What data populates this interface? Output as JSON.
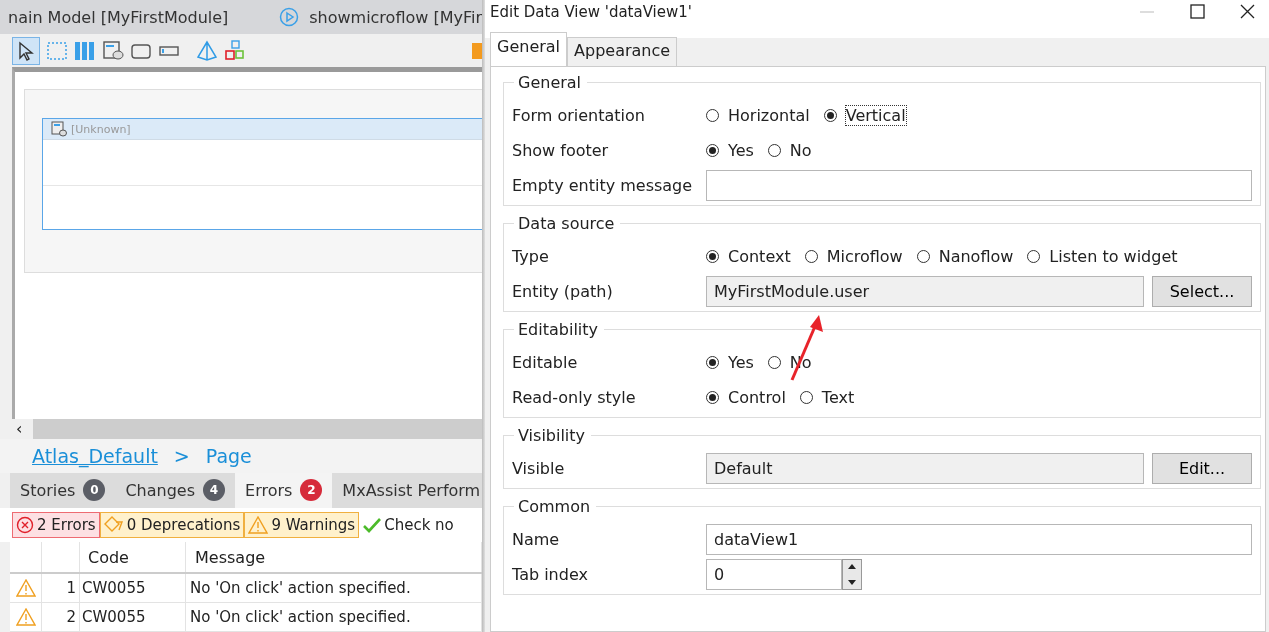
{
  "editor": {
    "tabs": [
      {
        "kind": "model",
        "label": "nain Model [MyFirstModule]"
      },
      {
        "kind": "microflow",
        "label": "showmicroflow [MyFir"
      }
    ],
    "canvas": {
      "widget_label": "[Unknown]"
    },
    "scroll_button": "‹",
    "breadcrumb": {
      "link": "Atlas_Default",
      "separator": ">",
      "current": "Page"
    },
    "panel_tabs": [
      {
        "label": "Stories",
        "count": "0",
        "color": "#5b5e66",
        "selected": false
      },
      {
        "label": "Changes",
        "count": "4",
        "color": "#5b5e66",
        "selected": false
      },
      {
        "label": "Errors",
        "count": "2",
        "color": "#d62b3a",
        "selected": true
      },
      {
        "label": "MxAssist Perform",
        "selected": false
      }
    ],
    "filters": [
      {
        "kind": "error",
        "label": "2 Errors"
      },
      {
        "kind": "deprecation",
        "label": "0 Deprecations"
      },
      {
        "kind": "warning",
        "label": "9 Warnings"
      },
      {
        "kind": "check",
        "label": "Check no"
      }
    ],
    "table": {
      "columns": [
        "Code",
        "Message"
      ],
      "rows": [
        {
          "kind": "warning",
          "index": "1",
          "code": "CW0055",
          "message": "No 'On click' action specified."
        },
        {
          "kind": "warning",
          "index": "2",
          "code": "CW0055",
          "message": "No 'On click' action specified."
        }
      ]
    }
  },
  "dialog": {
    "title": "Edit Data View 'dataView1'",
    "tabs": [
      {
        "label": "General",
        "selected": true
      },
      {
        "label": "Appearance",
        "selected": false
      }
    ],
    "groups": [
      {
        "title": "General",
        "rows": [
          {
            "kind": "radio",
            "label": "Form orientation",
            "options": [
              {
                "label": "Horizontal",
                "selected": false,
                "focused": false
              },
              {
                "label": "Vertical",
                "selected": true,
                "focused": true
              }
            ]
          },
          {
            "kind": "radio",
            "label": "Show footer",
            "options": [
              {
                "label": "Yes",
                "selected": true,
                "focused": false
              },
              {
                "label": "No",
                "selected": false,
                "focused": false
              }
            ]
          },
          {
            "kind": "text",
            "label": "Empty entity message"
          }
        ]
      },
      {
        "title": "Data source",
        "rows": [
          {
            "kind": "radio",
            "label": "Type",
            "options": [
              {
                "label": "Context",
                "selected": true,
                "focused": false
              },
              {
                "label": "Microflow",
                "selected": false,
                "focused": false
              },
              {
                "label": "Nanoflow",
                "selected": false,
                "focused": false
              },
              {
                "label": "Listen to widget",
                "selected": false,
                "focused": false
              }
            ]
          },
          {
            "kind": "picker",
            "label": "Entity (path)",
            "value": "MyFirstModule.user",
            "button": "Select..."
          }
        ]
      },
      {
        "title": "Editability",
        "rows": [
          {
            "kind": "radio",
            "label": "Editable",
            "options": [
              {
                "label": "Yes",
                "selected": true,
                "focused": false
              },
              {
                "label": "No",
                "selected": false,
                "focused": false
              }
            ]
          },
          {
            "kind": "radio",
            "label": "Read-only style",
            "options": [
              {
                "label": "Control",
                "selected": true,
                "focused": false
              },
              {
                "label": "Text",
                "selected": false,
                "focused": false
              }
            ]
          }
        ]
      },
      {
        "title": "Visibility",
        "rows": [
          {
            "kind": "picker",
            "label": "Visible",
            "value": "Default",
            "button": "Edit..."
          }
        ]
      },
      {
        "title": "Common",
        "rows": [
          {
            "kind": "text",
            "label": "Name",
            "value": "dataView1"
          },
          {
            "kind": "spin",
            "label": "Tab index",
            "value": "0"
          }
        ]
      }
    ]
  }
}
